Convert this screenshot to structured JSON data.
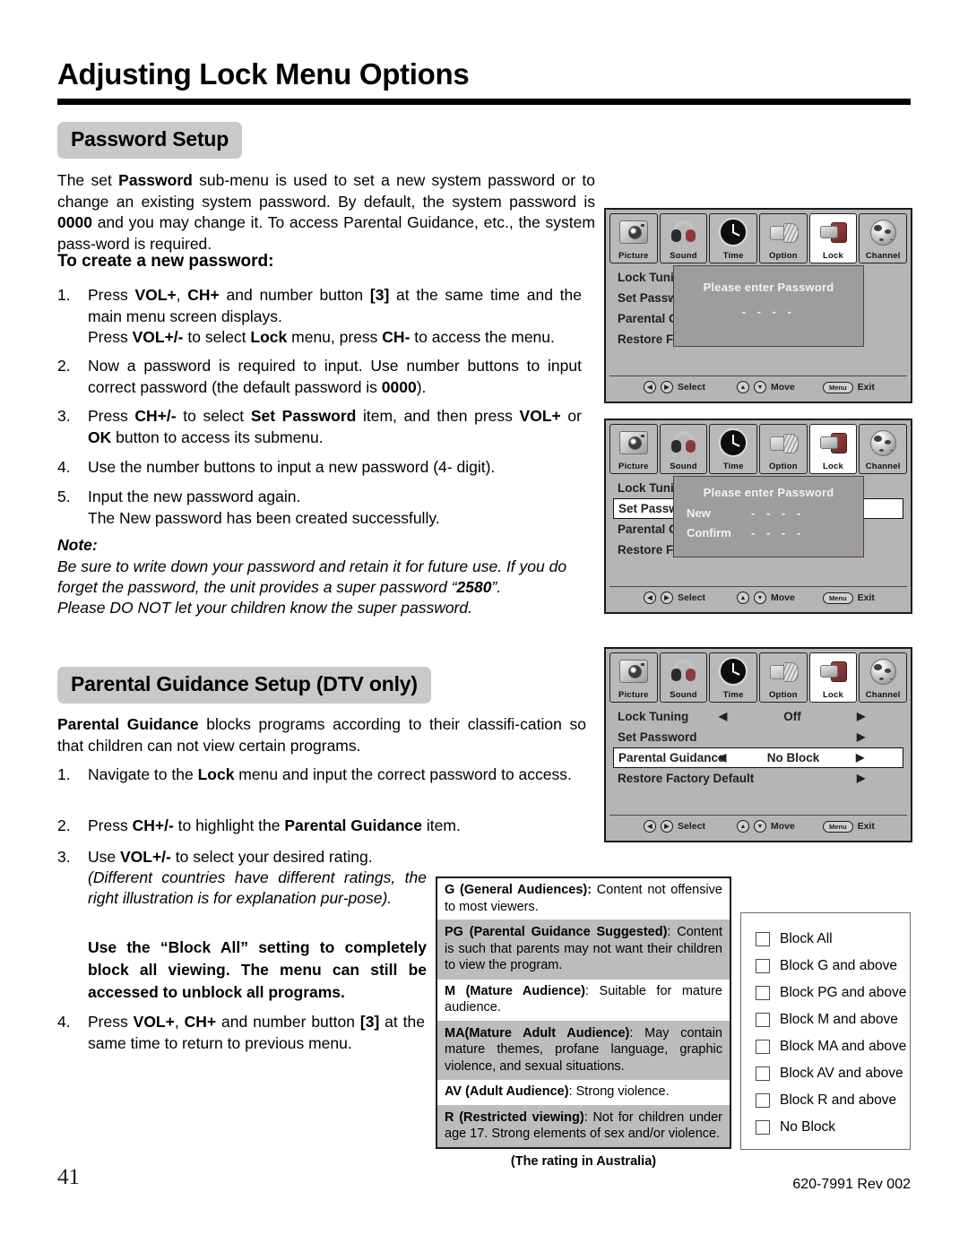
{
  "page": {
    "title": "Adjusting Lock Menu Options",
    "number": "41",
    "doc_code": "620-7991 Rev 002"
  },
  "password_section": {
    "banner": "Password Setup",
    "intro_parts": [
      {
        "t": "The set ",
        "b": false
      },
      {
        "t": "Password",
        "b": true
      },
      {
        "t": " sub-menu is used to set a new system password or to change an existing system password. By default, the system password is ",
        "b": false
      },
      {
        "t": "0000",
        "b": true
      },
      {
        "t": " and you may change it. To access Parental Guidance, etc., the system pass-word is required.",
        "b": false
      }
    ],
    "subhead": "To create a new password:",
    "steps": [
      {
        "num": "1.",
        "parts": [
          {
            "t": "Press ",
            "b": false
          },
          {
            "t": "VOL+",
            "b": true
          },
          {
            "t": ", ",
            "b": false
          },
          {
            "t": "CH+",
            "b": true
          },
          {
            "t": " and number button ",
            "b": false
          },
          {
            "t": "[3]",
            "b": true
          },
          {
            "t": " at the same time and the main menu screen displays.",
            "b": false
          },
          {
            "t": "\n",
            "b": false
          },
          {
            "t": "Press ",
            "b": false
          },
          {
            "t": "VOL+/-",
            "b": true
          },
          {
            "t": " to select ",
            "b": false
          },
          {
            "t": "Lock",
            "b": true
          },
          {
            "t": " menu, press ",
            "b": false
          },
          {
            "t": "CH-",
            "b": true
          },
          {
            "t": " to access the menu.",
            "b": false
          }
        ]
      },
      {
        "num": "2.",
        "parts": [
          {
            "t": "Now a password is required to input. Use number buttons to input correct password (the default password is ",
            "b": false
          },
          {
            "t": "0000",
            "b": true
          },
          {
            "t": ").",
            "b": false
          }
        ]
      },
      {
        "num": "3.",
        "parts": [
          {
            "t": "Press ",
            "b": false
          },
          {
            "t": "CH+/-",
            "b": true
          },
          {
            "t": " to select ",
            "b": false
          },
          {
            "t": "Set Password",
            "b": true
          },
          {
            "t": " item, and then press ",
            "b": false
          },
          {
            "t": "VOL+",
            "b": true
          },
          {
            "t": " or ",
            "b": false
          },
          {
            "t": "OK",
            "b": true
          },
          {
            "t": " button to access its submenu.",
            "b": false
          }
        ]
      },
      {
        "num": "4.",
        "parts": [
          {
            "t": "Use the number buttons to input a new password (4- digit).",
            "b": false
          }
        ]
      },
      {
        "num": "5.",
        "parts": [
          {
            "t": "Input the new password again.",
            "b": false
          },
          {
            "t": "\n",
            "b": false
          },
          {
            "t": "The New password has been created successfully.",
            "b": false
          }
        ]
      }
    ],
    "note_head": "Note:",
    "note_parts": [
      {
        "t": "Be sure to write down your password and retain it for future use. If you do forget the password, the unit provides a super password “",
        "b": false
      },
      {
        "t": "2580",
        "b": true
      },
      {
        "t": "”.",
        "b": false
      },
      {
        "t": "\n",
        "b": false
      },
      {
        "t": "Please DO NOT let your children know the super password.",
        "b": false
      }
    ]
  },
  "parental_section": {
    "banner": "Parental Guidance Setup (DTV only)",
    "intro_parts": [
      {
        "t": "Parental Guidance",
        "b": true
      },
      {
        "t": " blocks programs according to their classifi-cation so that children can not view certain programs.",
        "b": false
      }
    ],
    "steps": [
      {
        "num": "1.",
        "parts": [
          {
            "t": "Navigate to the ",
            "b": false
          },
          {
            "t": "Lock",
            "b": true
          },
          {
            "t": " menu and input the correct password to access.",
            "b": false
          }
        ]
      },
      {
        "num": "2.",
        "parts": [
          {
            "t": "Press ",
            "b": false
          },
          {
            "t": "CH+/-",
            "b": true
          },
          {
            "t": " to highlight the ",
            "b": false
          },
          {
            "t": "Parental Guidance",
            "b": true
          },
          {
            "t": " item.",
            "b": false
          }
        ]
      },
      {
        "num": "3.",
        "parts": [
          {
            "t": "Use ",
            "b": false
          },
          {
            "t": "VOL+/-",
            "b": true
          },
          {
            "t": " to select your desired rating.",
            "b": false
          }
        ]
      },
      {
        "num": "4.",
        "parts": [
          {
            "t": "Press ",
            "b": false
          },
          {
            "t": "VOL+",
            "b": true
          },
          {
            "t": ", ",
            "b": false
          },
          {
            "t": "CH+",
            "b": true
          },
          {
            "t": " and number button ",
            "b": false
          },
          {
            "t": "[3]",
            "b": true
          },
          {
            "t": " at the same time to return to previous menu.",
            "b": false
          }
        ]
      }
    ],
    "italic_note": "(Different countries have different ratings, the right illustration is for explanation pur-pose).",
    "bold_note": "Use the “Block All” setting to completely block all viewing. The menu can still be accessed to unblock all programs."
  },
  "osd": {
    "icons": [
      {
        "label": "Picture",
        "icon": "camera-icon",
        "selected": false
      },
      {
        "label": "Sound",
        "icon": "headphones-icon",
        "selected": false
      },
      {
        "label": "Time",
        "icon": "clock-icon",
        "selected": false
      },
      {
        "label": "Option",
        "icon": "plug-icon",
        "selected": false
      },
      {
        "label": "Lock",
        "icon": "lock-icon",
        "selected": true
      },
      {
        "label": "Channel",
        "icon": "globe-icon",
        "selected": false
      }
    ],
    "footer": {
      "select": "Select",
      "move": "Move",
      "exit": "Exit",
      "menu_key": "Menu",
      "left_key": "◀",
      "right_key": "▶",
      "up_key": "▲",
      "down_key": "▼"
    },
    "screen1": {
      "rows": [
        {
          "label": "Lock Tuni",
          "highlight": false
        },
        {
          "label": "Set Passw",
          "highlight": false
        },
        {
          "label": "Parental G",
          "highlight": false
        },
        {
          "label": "Restore F",
          "highlight": false
        }
      ],
      "dialog": {
        "title": "Please enter Password",
        "dashes": "- - - -"
      }
    },
    "screen2": {
      "rows": [
        {
          "label": "Lock Tuni",
          "highlight": false
        },
        {
          "label": "Set Passw",
          "highlight": true
        },
        {
          "label": "Parental G",
          "highlight": false
        },
        {
          "label": "Restore F",
          "highlight": false
        }
      ],
      "dialog": {
        "title": "Please enter Password",
        "new_label": "New",
        "new_dashes": "- - - -",
        "confirm_label": "Confirm",
        "confirm_dashes": "- - - -"
      }
    },
    "screen3": {
      "rows": [
        {
          "label": "Lock Tuning",
          "value": "Off",
          "arrows": true,
          "highlight": false
        },
        {
          "label": "Set Password",
          "value": "",
          "arrows": false,
          "highlight": false
        },
        {
          "label": "Parental Guidance",
          "value": "No Block",
          "arrows": true,
          "highlight": true
        },
        {
          "label": "Restore Factory Default",
          "value": "",
          "arrows": false,
          "highlight": false
        }
      ]
    }
  },
  "ratings_table": {
    "caption": "(The rating in Australia)",
    "rows": [
      {
        "shade": false,
        "parts": [
          {
            "t": "G  (General  Audiences): ",
            "b": true
          },
          {
            "t": "Content not offensive to most viewers.",
            "b": false
          }
        ]
      },
      {
        "shade": true,
        "parts": [
          {
            "t": "PG  (Parental  Guidance  Suggested)",
            "b": true
          },
          {
            "t": ": Content is such that parents may not want their children to view the program.",
            "b": false
          }
        ]
      },
      {
        "shade": false,
        "parts": [
          {
            "t": "M (Mature Audience)",
            "b": true
          },
          {
            "t": ": Suitable for mature audience.",
            "b": false
          }
        ]
      },
      {
        "shade": true,
        "parts": [
          {
            "t": "MA(Mature Adult Audience)",
            "b": true
          },
          {
            "t": ": May contain mature themes, profane language, graphic violence, and sexual situations.",
            "b": false
          }
        ]
      },
      {
        "shade": false,
        "parts": [
          {
            "t": "AV (Adult Audience)",
            "b": true
          },
          {
            "t": ": Strong violence.",
            "b": false
          }
        ]
      },
      {
        "shade": true,
        "parts": [
          {
            "t": "R  (Restricted  viewing)",
            "b": true
          },
          {
            "t": ": Not for children under age 17. Strong elements of sex and/or violence.",
            "b": false
          }
        ]
      }
    ]
  },
  "block_list": {
    "items": [
      "Block All",
      "Block G and above",
      "Block PG and above",
      "Block M and above",
      "Block MA and above",
      "Block AV and above",
      "Block R and above",
      "No Block"
    ]
  }
}
